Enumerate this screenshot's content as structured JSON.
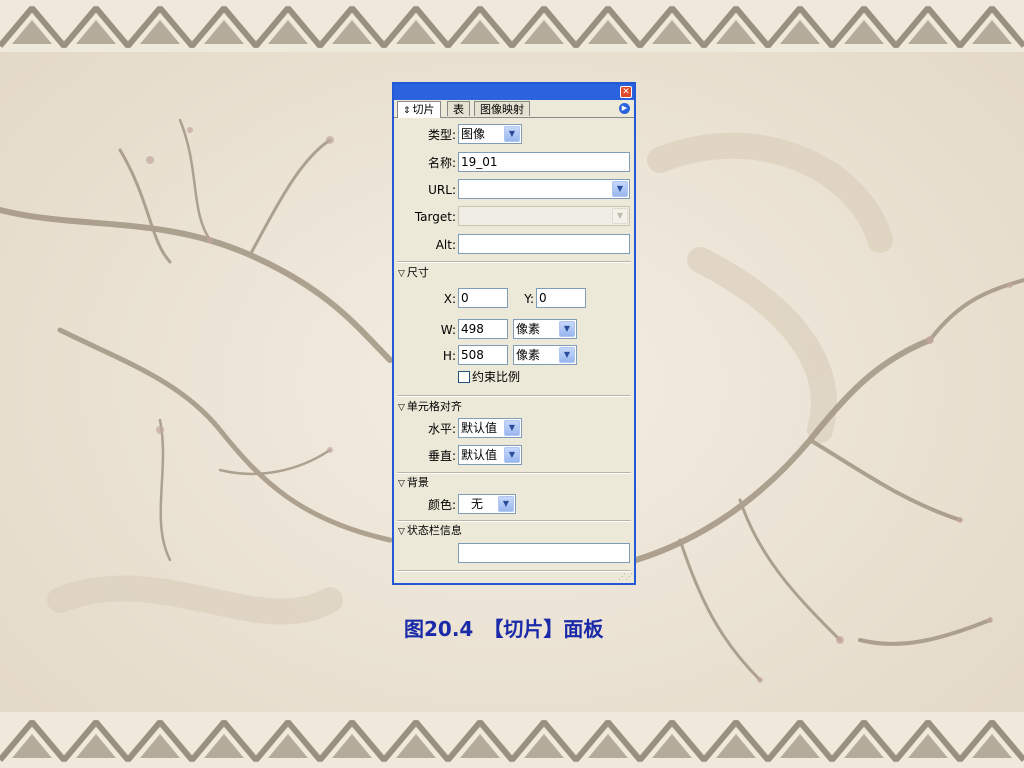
{
  "panel": {
    "tabs": [
      {
        "label": "切片",
        "grip": "⇕"
      },
      {
        "label": "表"
      },
      {
        "label": "图像映射"
      }
    ],
    "close_icon": "close-icon",
    "menu_icon": "panel-menu-icon",
    "type": {
      "label": "类型:",
      "value": "图像"
    },
    "name": {
      "label": "名称:",
      "value": "19_01"
    },
    "url": {
      "label": "URL:",
      "value": ""
    },
    "target": {
      "label": "Target:",
      "value": ""
    },
    "alt": {
      "label": "Alt:",
      "value": ""
    },
    "size_section": {
      "title": "尺寸",
      "x": {
        "label": "X:",
        "value": "0"
      },
      "y": {
        "label": "Y:",
        "value": "0"
      },
      "w": {
        "label": "W:",
        "value": "498",
        "unit": "像素"
      },
      "h": {
        "label": "H:",
        "value": "508",
        "unit": "像素"
      },
      "constrain": {
        "label": "约束比例",
        "checked": false
      }
    },
    "cell_align_section": {
      "title": "单元格对齐",
      "horizontal": {
        "label": "水平:",
        "value": "默认值"
      },
      "vertical": {
        "label": "垂直:",
        "value": "默认值"
      }
    },
    "background_section": {
      "title": "背景",
      "color": {
        "label": "颜色:",
        "value": "无"
      }
    },
    "status_section": {
      "title": "状态栏信息",
      "value": ""
    }
  },
  "caption": "图20.4　【切片】面板",
  "colors": {
    "panel_border": "#2459d6",
    "panel_bg": "#ece9d8",
    "caption": "#1a2aa8",
    "border_band": "#9a9080"
  }
}
